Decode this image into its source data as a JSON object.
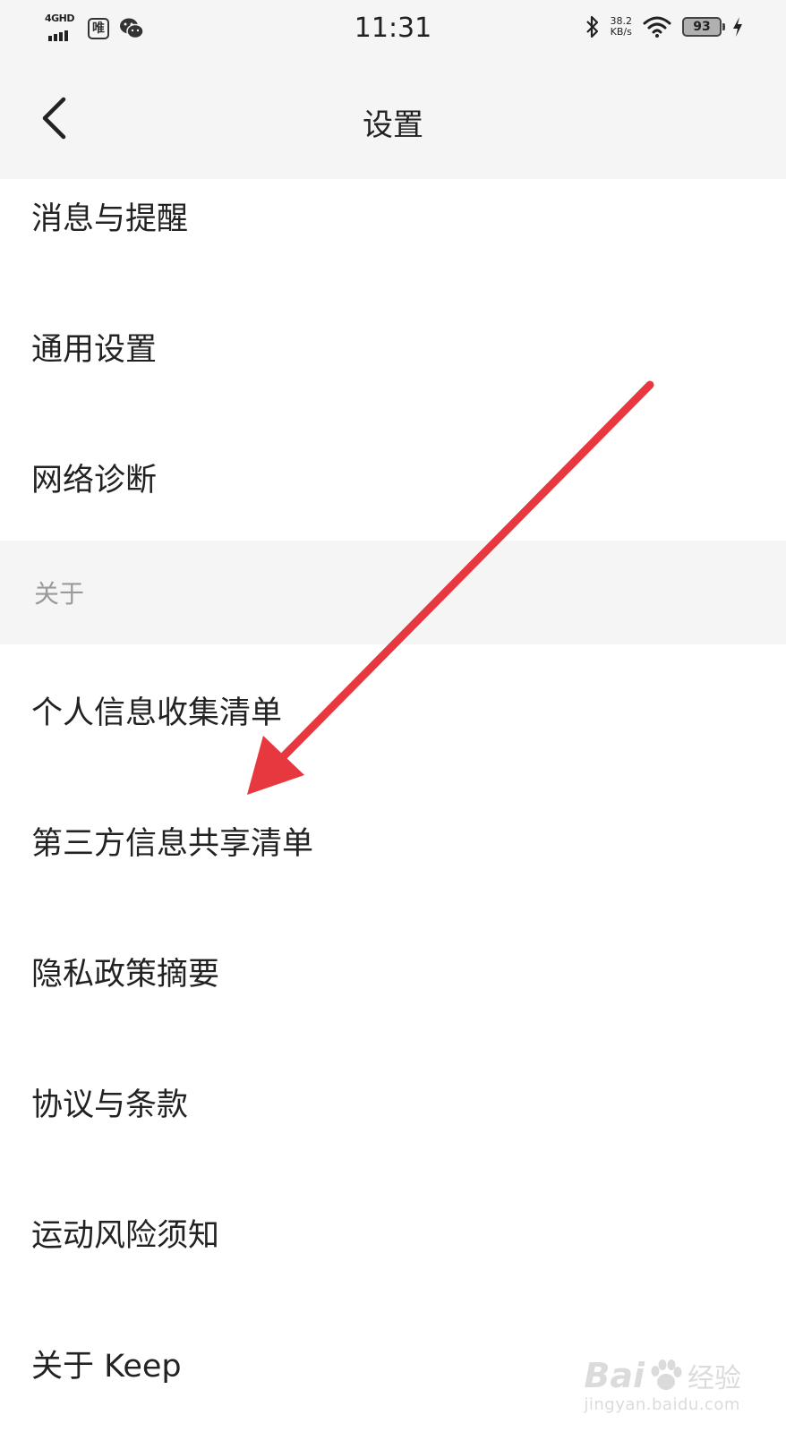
{
  "status_bar": {
    "network": "4GHD",
    "app_icon_text": "唯",
    "time": "11:31",
    "speed_value": "38.2",
    "speed_unit": "KB/s",
    "battery": "93"
  },
  "nav": {
    "title": "设置"
  },
  "items_top": [
    {
      "label": "消息与提醒"
    },
    {
      "label": "通用设置"
    },
    {
      "label": "网络诊断"
    }
  ],
  "section_about": {
    "label": "关于"
  },
  "items_about": [
    {
      "label": "个人信息收集清单"
    },
    {
      "label": "第三方信息共享清单"
    },
    {
      "label": "隐私政策摘要"
    },
    {
      "label": "协议与条款"
    },
    {
      "label": "运动风险须知"
    },
    {
      "label": "关于 Keep"
    }
  ],
  "watermark": {
    "brand": "Bai",
    "suffix": "经验",
    "url": "jingyan.baidu.com"
  },
  "colors": {
    "annotation_arrow": "#e8383f",
    "header_bg": "#f5f5f5",
    "section_label": "#9a9a9a"
  }
}
